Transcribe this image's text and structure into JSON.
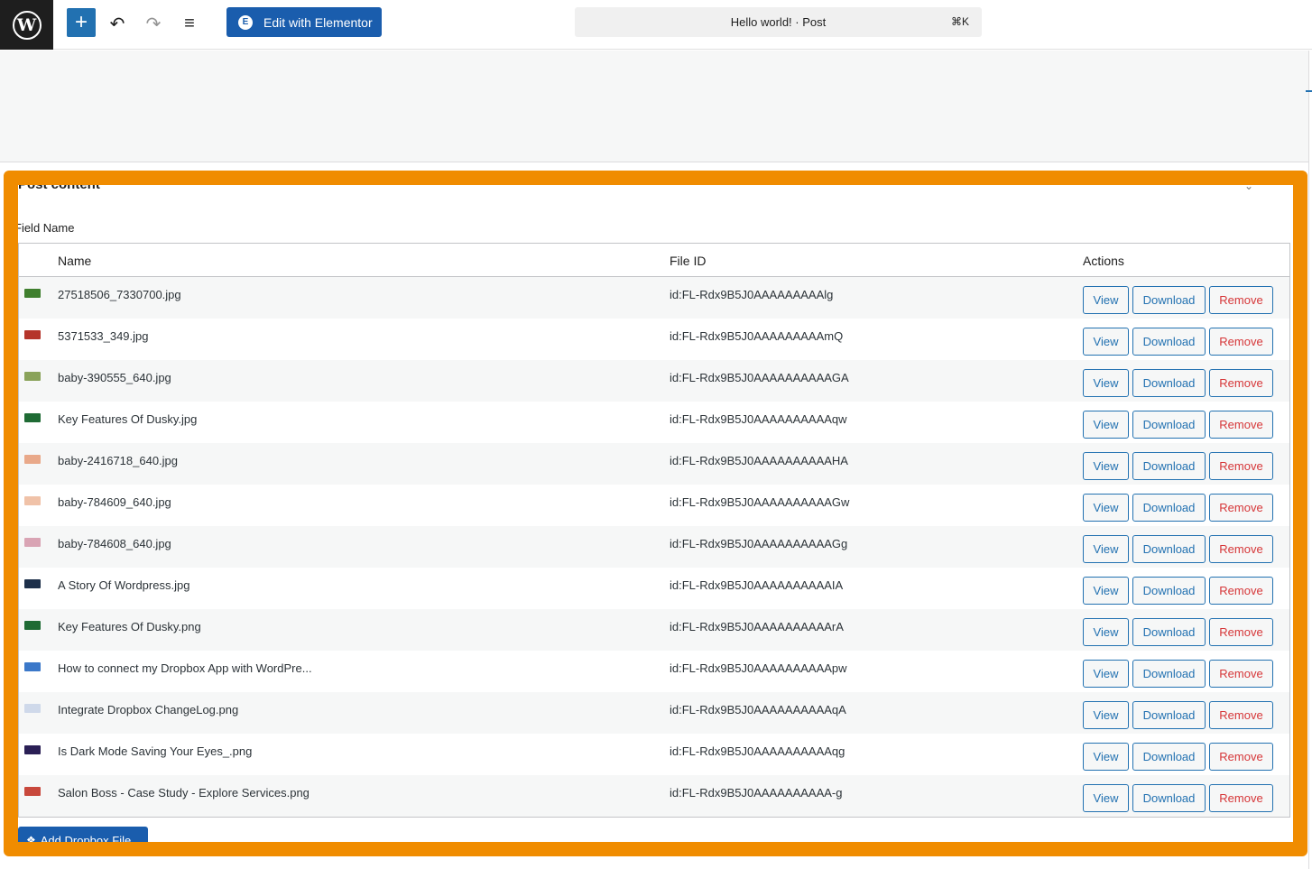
{
  "toolbar": {
    "logo": "W",
    "add_icon": "+",
    "undo_icon": "↶",
    "redo_icon": "↷",
    "list_icon": "≡",
    "elementor_label": "Edit with Elementor",
    "elementor_badge": "E",
    "command_title": "Hello world! · Post",
    "command_shortcut": "⌘K"
  },
  "panel": {
    "title": "Post content",
    "field_label": "Field Name",
    "columns": {
      "name": "Name",
      "file_id": "File ID",
      "actions": "Actions"
    },
    "view_label": "View",
    "download_label": "Download",
    "remove_label": "Remove",
    "add_button_label": "Add Dropbox File",
    "add_button_icon": "❖"
  },
  "files": [
    {
      "name": "27518506_7330700.jpg",
      "file_id": "id:FL-Rdx9B5J0AAAAAAAAAlg",
      "thumb_color": "#3f7f2e"
    },
    {
      "name": "5371533_349.jpg",
      "file_id": "id:FL-Rdx9B5J0AAAAAAAAAmQ",
      "thumb_color": "#b5352a"
    },
    {
      "name": "baby-390555_640.jpg",
      "file_id": "id:FL-Rdx9B5J0AAAAAAAAAAGA",
      "thumb_color": "#8aa35a"
    },
    {
      "name": "Key Features Of Dusky.jpg",
      "file_id": "id:FL-Rdx9B5J0AAAAAAAAAAqw",
      "thumb_color": "#1f6b34"
    },
    {
      "name": "baby-2416718_640.jpg",
      "file_id": "id:FL-Rdx9B5J0AAAAAAAAAAHA",
      "thumb_color": "#e9a98a"
    },
    {
      "name": "baby-784609_640.jpg",
      "file_id": "id:FL-Rdx9B5J0AAAAAAAAAAGw",
      "thumb_color": "#f0c2a8"
    },
    {
      "name": "baby-784608_640.jpg",
      "file_id": "id:FL-Rdx9B5J0AAAAAAAAAAGg",
      "thumb_color": "#d9a4b4"
    },
    {
      "name": "A Story Of Wordpress.jpg",
      "file_id": "id:FL-Rdx9B5J0AAAAAAAAAAIA",
      "thumb_color": "#1d2f4a"
    },
    {
      "name": "Key Features Of Dusky.png",
      "file_id": "id:FL-Rdx9B5J0AAAAAAAAAArA",
      "thumb_color": "#1f6b34"
    },
    {
      "name": "How to connect my Dropbox App with WordPre...",
      "file_id": "id:FL-Rdx9B5J0AAAAAAAAAApw",
      "thumb_color": "#3b78c9"
    },
    {
      "name": "Integrate Dropbox ChangeLog.png",
      "file_id": "id:FL-Rdx9B5J0AAAAAAAAAAqA",
      "thumb_color": "#cfd9ea"
    },
    {
      "name": "Is Dark Mode Saving Your Eyes_.png",
      "file_id": "id:FL-Rdx9B5J0AAAAAAAAAAqg",
      "thumb_color": "#2a1f55"
    },
    {
      "name": "Salon Boss - Case Study - Explore Services.png",
      "file_id": "id:FL-Rdx9B5J0AAAAAAAAAA-g",
      "thumb_color": "#c8483c"
    }
  ]
}
